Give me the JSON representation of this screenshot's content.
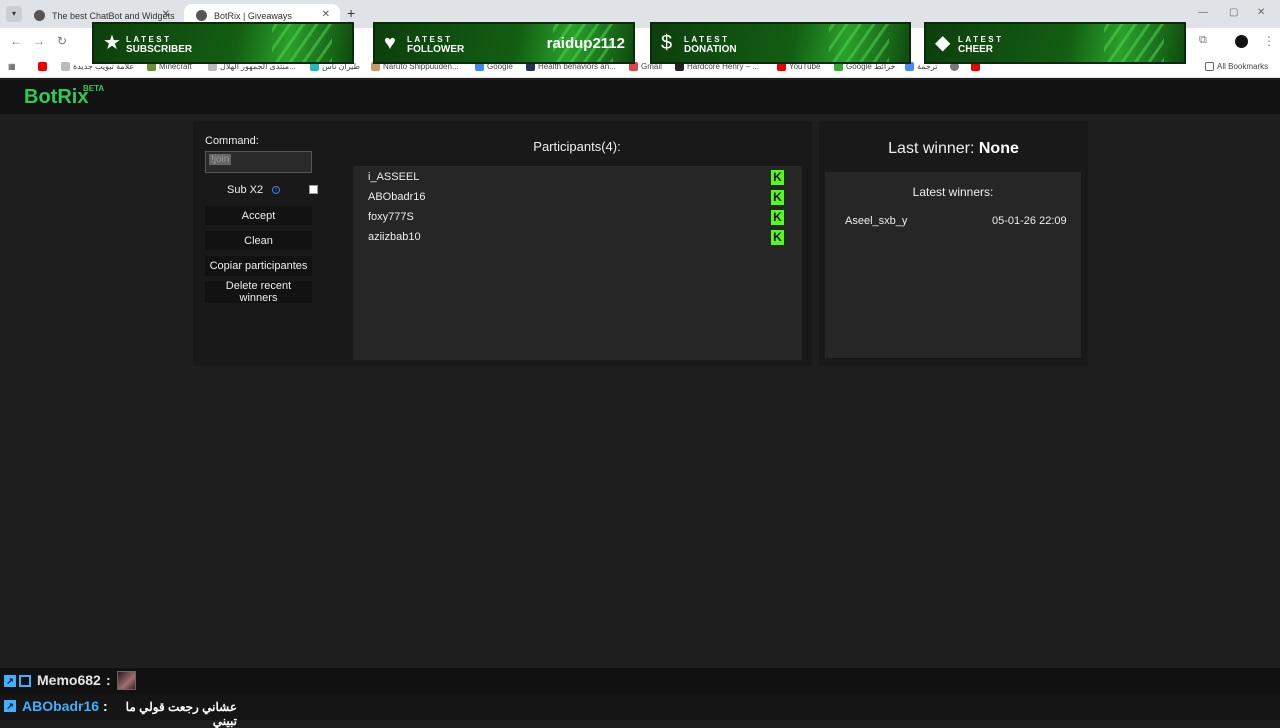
{
  "browser": {
    "tabs": [
      {
        "title": "The best ChatBot and Widgets"
      },
      {
        "title": "BotRix | Giveaways"
      }
    ],
    "new_tab": "+",
    "tab_menu": "▾",
    "window_controls": {
      "minimize": "—",
      "maximize": "▢",
      "close": "✕"
    },
    "bookmarks": [
      {
        "label": "علامة تبويب جديدة"
      },
      {
        "label": "Minecraft"
      },
      {
        "label": "منتدى الجمهور الهلال..."
      },
      {
        "label": "طيران ناس"
      },
      {
        "label": "Naruto Shippuuden..."
      },
      {
        "label": "Google"
      },
      {
        "label": "Health behaviors an..."
      },
      {
        "label": "Gmail"
      },
      {
        "label": "Hardcore Henry – ..."
      },
      {
        "label": "YouTube"
      },
      {
        "label": "Google خرائط"
      },
      {
        "label": "ترجمة"
      }
    ],
    "all_bookmarks": "All Bookmarks"
  },
  "alerts": [
    {
      "line1": "LATEST",
      "line2": "SUBSCRIBER",
      "name": "",
      "icon": "star-icon"
    },
    {
      "line1": "LATEST",
      "line2": "FOLLOWER",
      "name": "raidup2112",
      "icon": "heart-icon"
    },
    {
      "line1": "LATEST",
      "line2": "DONATION",
      "name": "",
      "icon": "dollar-icon"
    },
    {
      "line1": "LATEST",
      "line2": "CHEER",
      "name": "",
      "icon": "diamond-icon"
    }
  ],
  "app": {
    "logo": "BotRix",
    "logo_badge": "BETA",
    "command_label": "Command:",
    "command_value": "!join",
    "sub_label": "Sub X2",
    "buttons": {
      "accept": "Accept",
      "clean": "Clean",
      "copy": "Copiar participantes",
      "delete": "Delete recent winners"
    },
    "participants_title": "Participants(4):",
    "participants": [
      "i_ASSEEL",
      "ABObadr16",
      "foxy777S",
      "aziizbab10"
    ],
    "last_winner_label": "Last winner:",
    "last_winner_value": "None",
    "latest_winners_title": "Latest winners:",
    "latest_winners": [
      {
        "name": "Aseel_sxb_y",
        "date": "05-01-26 22:09"
      }
    ]
  },
  "chat": [
    {
      "user": "Memo682",
      "sep": ":",
      "message": ""
    },
    {
      "user": "ABObadr16",
      "sep": ":",
      "message": "عشاني رجعت قولي ما تبيني"
    }
  ],
  "colors": {
    "brand": "#2ecc55",
    "kick": "#53fc18",
    "chat_user": "#3fb0ff"
  }
}
